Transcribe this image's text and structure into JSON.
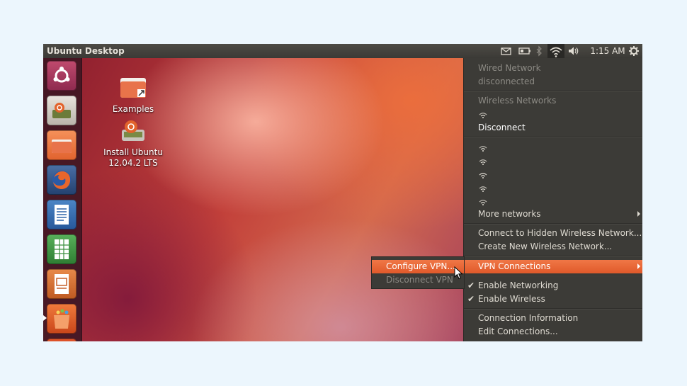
{
  "topbar": {
    "title": "Ubuntu Desktop",
    "clock": "1:15 AM",
    "indicators": [
      "mail-icon",
      "battery-icon",
      "bluetooth-icon",
      "wifi-icon",
      "volume-icon",
      "gear-icon"
    ]
  },
  "launcher": {
    "items": [
      "dash-home",
      "install-ubuntu",
      "files",
      "firefox",
      "libreoffice-writer",
      "libreoffice-calc",
      "libreoffice-impress",
      "ubuntu-software-center",
      "more"
    ]
  },
  "desktop": {
    "icons": [
      {
        "label": "Examples"
      },
      {
        "label": "Install Ubuntu 12.04.2 LTS"
      }
    ]
  },
  "network_menu": {
    "wired_header": "Wired Network",
    "wired_status": "disconnected",
    "wireless_header": "Wireless Networks",
    "disconnect": "Disconnect",
    "more_networks": "More networks",
    "connect_hidden": "Connect to Hidden Wireless Network...",
    "create_new": "Create New Wireless Network...",
    "vpn_connections": "VPN Connections",
    "enable_networking": "Enable Networking",
    "enable_wireless": "Enable Wireless",
    "connection_info": "Connection Information",
    "edit_connections": "Edit Connections..."
  },
  "vpn_submenu": {
    "configure": "Configure VPN...",
    "disconnect": "Disconnect VPN"
  },
  "colors": {
    "highlight": "#e95420",
    "menu_bg": "#3c3b37"
  }
}
